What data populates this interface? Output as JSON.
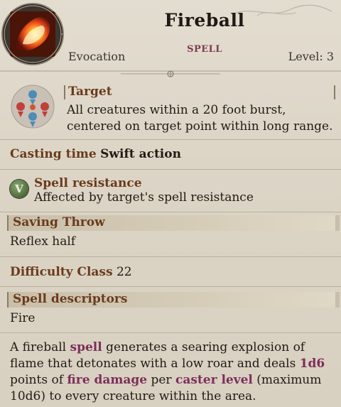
{
  "header": {
    "title": "Fireball",
    "type": "SPELL",
    "school": "Evocation",
    "level_label": "Level: 3",
    "icon": "fireball-icon"
  },
  "target": {
    "label": "Target",
    "text": "All creatures within a 20 foot burst, centered on target point within long range.",
    "icon": "area-target-icon"
  },
  "casting_time": {
    "label": "Casting time",
    "value": "Swift action"
  },
  "spell_resistance": {
    "label": "Spell resistance",
    "text": "Affected by target's spell resistance",
    "icon_letter": "V"
  },
  "saving_throw": {
    "label": "Saving Throw",
    "value": "Reflex half"
  },
  "difficulty_class": {
    "label": "Difficulty Class",
    "value": "22"
  },
  "spell_descriptors": {
    "label": "Spell descriptors",
    "value": "Fire"
  },
  "description": {
    "part1": "A fireball ",
    "kw1": "spell",
    "part2": " generates a searing explosion of flame that detonates with a low roar and deals ",
    "kw2": "1d6",
    "part3": " points of ",
    "kw3": "fire damage",
    "part4": " per ",
    "kw4": "caster level",
    "part5": " (maximum 10d6) to every creature within the area."
  },
  "colors": {
    "background": "#ddd6c7",
    "label": "#6a3a1c",
    "keyword": "#7c2e5a",
    "spell_type": "#7e3a52"
  }
}
